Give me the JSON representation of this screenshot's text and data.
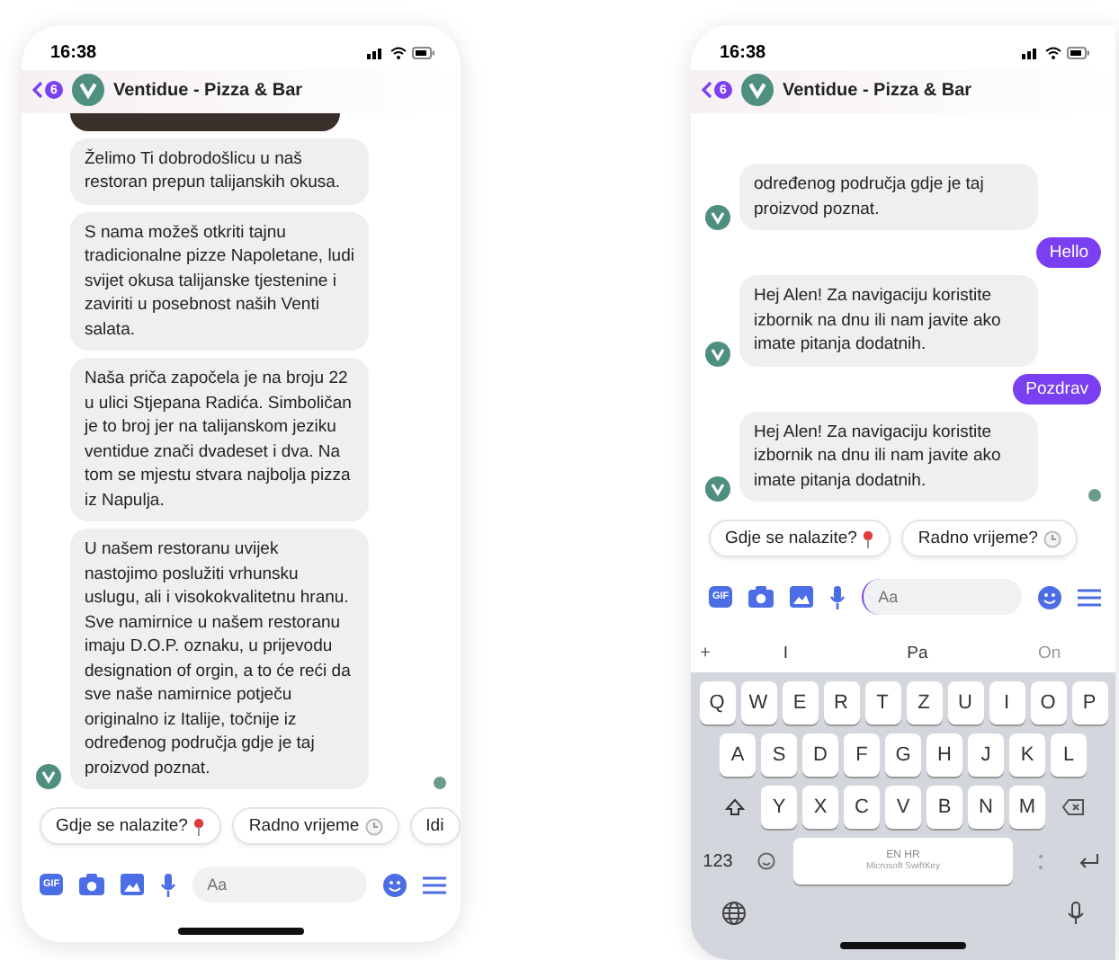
{
  "phones": [
    {
      "status_time": "16:38",
      "header": {
        "badge": "6",
        "title": "Ventidue - Pizza & Bar"
      },
      "messages": [
        {
          "kind": "image",
          "avatar": false,
          "seen": false
        },
        {
          "kind": "bot",
          "text": "Želimo Ti dobrodošlicu u naš restoran prepun talijanskih okusa.",
          "avatar": false,
          "seen": false
        },
        {
          "kind": "bot",
          "text": "S nama možeš otkriti tajnu tradicionalne pizze Napoletane, ludi svijet okusa talijanske tjestenine i zaviriti u posebnost naših Venti salata.",
          "avatar": false,
          "seen": false
        },
        {
          "kind": "bot",
          "text": "Naša priča započela je na broju 22 u ulici Stjepana Radića. Simboličan je to broj jer na talijanskom jeziku ventidue znači dvadeset i dva. Na tom se mjestu stvara najbolja pizza iz Napulja.",
          "avatar": false,
          "seen": false
        },
        {
          "kind": "bot",
          "text": "U našem restoranu uvijek nastojimo poslužiti vrhunsku uslugu, ali i visokokvalitetnu hranu. Sve namirnice u našem restoranu imaju D.O.P. oznaku, u prijevodu designation of orgin, a to će reći da sve naše namirnice potječu originalno iz Italije, točnije iz određenog područja gdje je taj proizvod poznat.",
          "avatar": true,
          "seen": true
        }
      ],
      "quick_replies": [
        {
          "label": "Gdje se nalazite?"
        },
        {
          "label": "Radno vrijeme"
        },
        {
          "label": "Idi"
        }
      ],
      "composer": {
        "gif_label": "GIF",
        "placeholder": "Aa",
        "focused": false
      }
    },
    {
      "status_time": "16:38",
      "header": {
        "badge": "6",
        "title": "Ventidue - Pizza & Bar"
      },
      "messages": [
        {
          "kind": "bot",
          "text": "određenog područja gdje je taj proizvod poznat.",
          "avatar": true,
          "seen": false
        },
        {
          "kind": "user",
          "text": "Hello",
          "avatar": false,
          "seen": false
        },
        {
          "kind": "bot",
          "text": "Hej Alen! Za navigaciju koristite izbornik na dnu ili nam javite ako imate pitanja dodatnih.",
          "avatar": true,
          "seen": false
        },
        {
          "kind": "user",
          "text": "Pozdrav",
          "avatar": false,
          "seen": false
        },
        {
          "kind": "bot",
          "text": "Hej Alen! Za navigaciju koristite izbornik na dnu ili nam javite ako imate pitanja dodatnih.",
          "avatar": true,
          "seen": true
        }
      ],
      "quick_replies": [
        {
          "label": "Gdje se nalazite?"
        },
        {
          "label": "Radno vrijeme?"
        }
      ],
      "composer": {
        "gif_label": "GIF",
        "placeholder": "Aa",
        "focused": true
      },
      "keyboard": {
        "plus_key": "+",
        "suggestions": [
          "I",
          "Pa",
          "On"
        ],
        "rows": [
          [
            "Q",
            "W",
            "E",
            "R",
            "T",
            "Z",
            "U",
            "I",
            "O",
            "P"
          ],
          [
            "A",
            "S",
            "D",
            "F",
            "G",
            "H",
            "J",
            "K",
            "L"
          ],
          [
            "Y",
            "X",
            "C",
            "V",
            "B",
            "N",
            "M"
          ]
        ],
        "numbers_key": "123",
        "space_top": "EN HR",
        "space_bottom": "Microsoft SwiftKey"
      }
    }
  ]
}
